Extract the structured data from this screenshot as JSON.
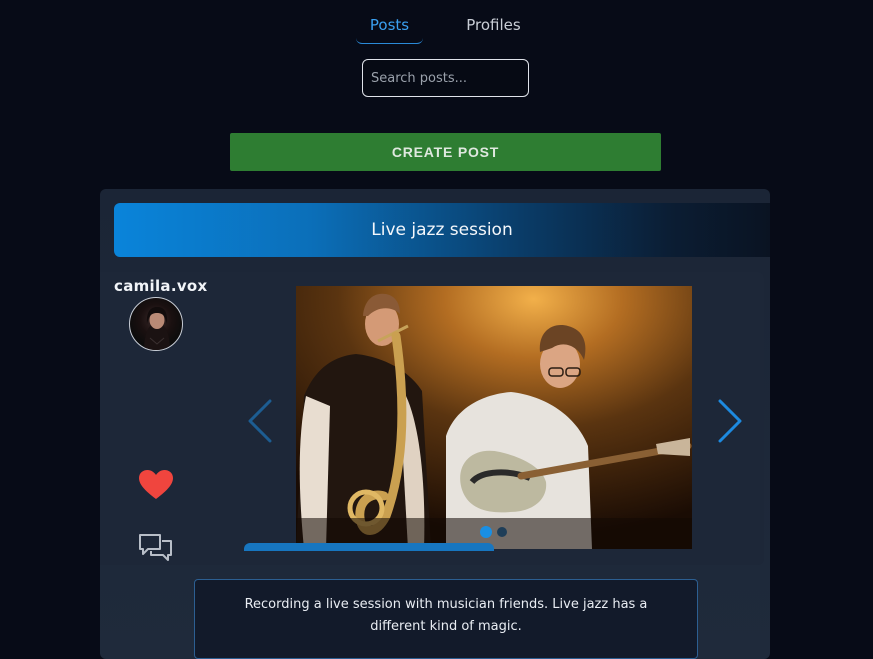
{
  "tabs": [
    {
      "label": "Posts",
      "active": true
    },
    {
      "label": "Profiles",
      "active": false
    }
  ],
  "search": {
    "placeholder": "Search posts...",
    "value": ""
  },
  "create_post": {
    "label": "CREATE POST"
  },
  "post": {
    "title": "Live jazz session",
    "username": "camila.vox",
    "caption": "Recording a live session with musician friends. Live jazz has a different kind of magic.",
    "liked": true,
    "carousel": {
      "slide_count": 2,
      "current_slide": 1,
      "progress": 0.5
    }
  },
  "icons": {
    "like": "heart-icon",
    "comment": "comment-icon",
    "prev": "chevron-left-icon",
    "next": "chevron-right-icon"
  },
  "colors": {
    "background": "#070b17",
    "accent": "#1a8fe3",
    "create_button": "#2e7d32",
    "like": "#f0453e"
  }
}
